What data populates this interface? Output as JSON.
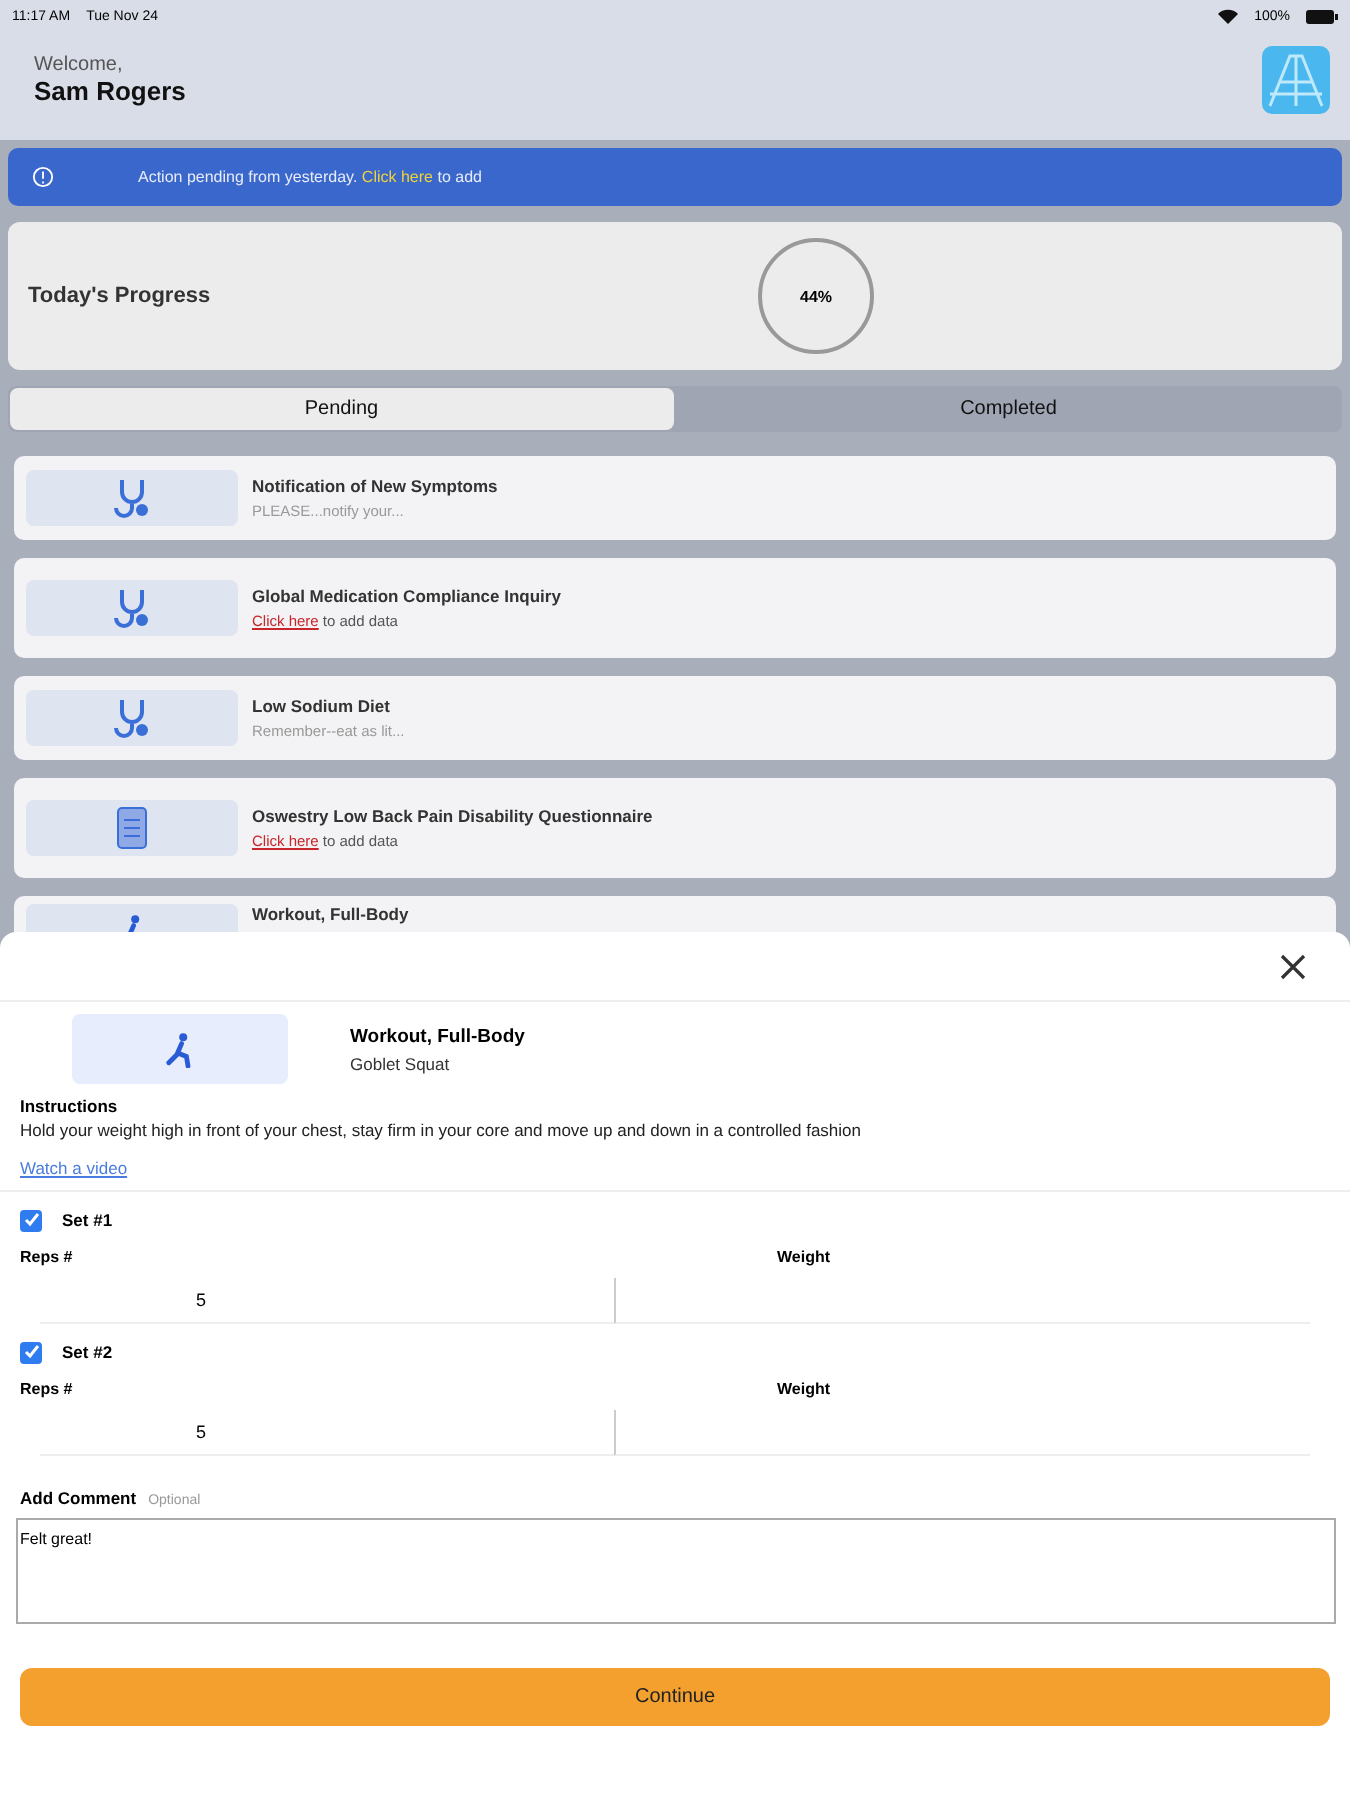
{
  "status_bar": {
    "time": "11:17 AM",
    "date": "Tue Nov 24",
    "battery": "100%"
  },
  "header": {
    "greeting": "Welcome,",
    "name": "Sam Rogers"
  },
  "banner": {
    "text": "Action pending from yesterday.",
    "link": "Click here",
    "suffix": "to add"
  },
  "progress": {
    "title": "Today's Progress",
    "value": "44%"
  },
  "tabs": [
    {
      "label": "Pending",
      "selected": true
    },
    {
      "label": "Completed",
      "selected": false
    }
  ],
  "tasks": [
    {
      "kind": "checkup",
      "title": "Notification of New Symptoms",
      "note": "PLEASE...notify your..."
    },
    {
      "kind": "checkup",
      "title": "Global Medication Compliance Inquiry",
      "link": "Click here",
      "suffix": "to add data"
    },
    {
      "kind": "checkup",
      "title": "Low Sodium Diet",
      "note": "Remember--eat as lit..."
    },
    {
      "kind": "questionnaire",
      "title": "Oswestry Low Back Pain Disability Questionnaire",
      "link": "Click here",
      "suffix": "to add data"
    },
    {
      "kind": "exercise",
      "title": "Workout, Full-Body"
    }
  ],
  "sheet": {
    "title": "Workout, Full-Body",
    "subtitle": "Goblet Squat",
    "instructions_label": "Instructions",
    "instructions": "Hold your weight high in front of your chest, stay firm in your core and move up and down in a controlled fashion",
    "video_link": "Watch a video",
    "sets": [
      {
        "label": "Set #1",
        "checked": true,
        "reps_label": "Reps #",
        "reps": "5",
        "weight_label": "Weight"
      },
      {
        "label": "Set #2",
        "checked": true,
        "reps_label": "Reps #",
        "reps": "5",
        "weight_label": "Weight"
      }
    ],
    "comment_label": "Add Comment",
    "comment_hint": "Optional",
    "comment": "Felt great!",
    "button": "Continue"
  }
}
